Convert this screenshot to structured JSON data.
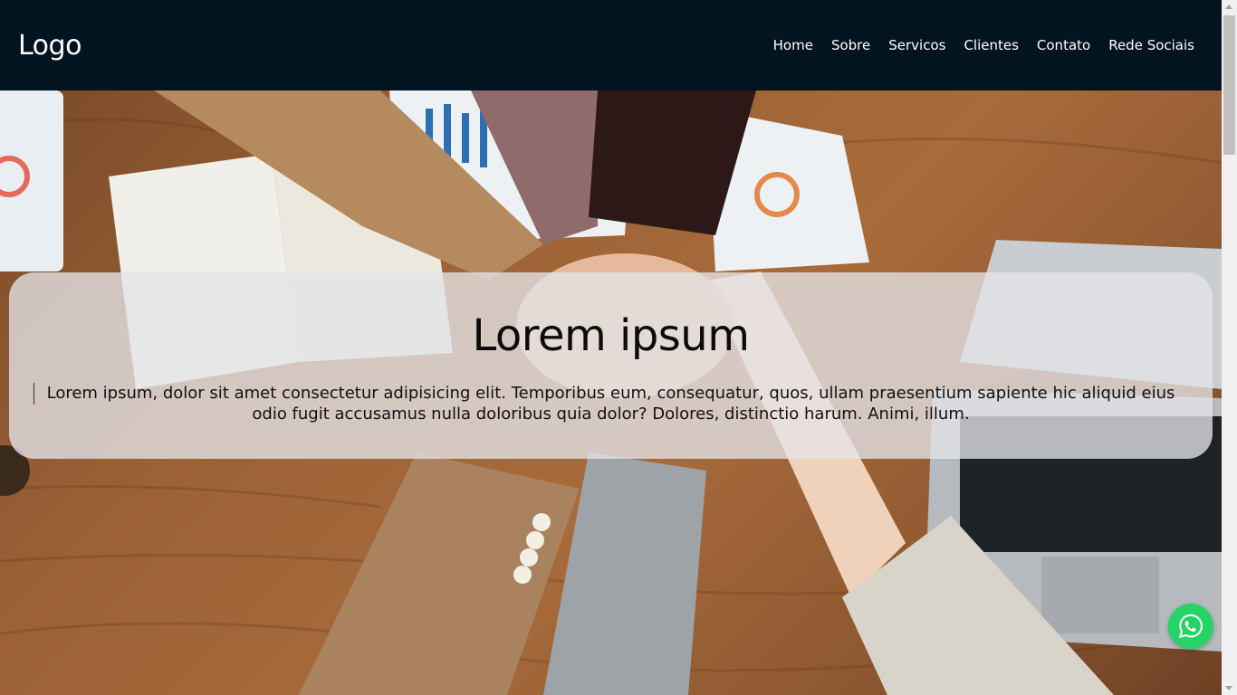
{
  "header": {
    "logo": "Logo",
    "nav": [
      {
        "label": "Home"
      },
      {
        "label": "Sobre"
      },
      {
        "label": "Servicos"
      },
      {
        "label": "Clientes"
      },
      {
        "label": "Contato"
      },
      {
        "label": "Rede Sociais"
      }
    ]
  },
  "hero": {
    "title": "Lorem ipsum",
    "text": "Lorem ipsum, dolor sit amet consectetur adipisicing elit. Temporibus eum, consequatur, quos, ullam praesentium sapiente hic aliquid eius odio fugit accusamus nulla doloribus quia dolor? Dolores, distinctio harum. Animi, illum."
  },
  "floating": {
    "icon": "whatsapp-icon",
    "color": "#25d366"
  },
  "colors": {
    "header_bg": "#021420",
    "card_bg": "rgba(228,228,232,0.78)"
  }
}
